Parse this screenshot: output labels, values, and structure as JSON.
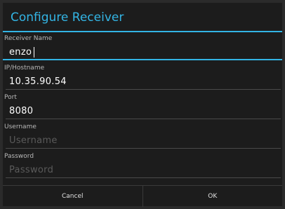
{
  "dialog": {
    "title": "Configure Receiver",
    "accent_color": "#33b5e5",
    "fields": [
      {
        "label": "Receiver Name",
        "value": "enzo",
        "placeholder": ""
      },
      {
        "label": "IP/Hostname",
        "value": "10.35.90.54",
        "placeholder": ""
      },
      {
        "label": "Port",
        "value": "8080",
        "placeholder": ""
      },
      {
        "label": "Username",
        "value": "",
        "placeholder": "Username"
      },
      {
        "label": "Password",
        "value": "",
        "placeholder": "Password"
      }
    ],
    "buttons": {
      "cancel": "Cancel",
      "ok": "OK"
    }
  }
}
